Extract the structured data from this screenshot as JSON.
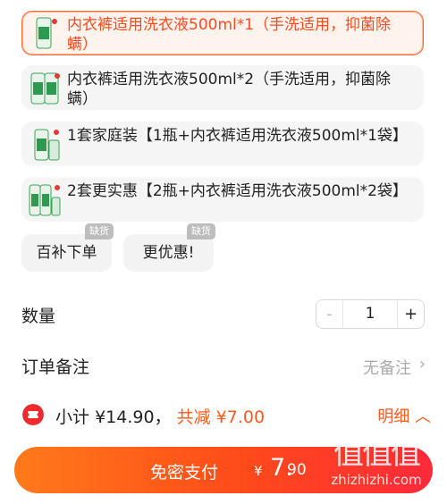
{
  "sku_options": [
    {
      "label": "内衣裤适用洗衣液500ml*1（手洗适用，抑菌除螨）",
      "selected": true
    },
    {
      "label": "内衣裤适用洗衣液500ml*2（手洗适用，抑菌除螨）",
      "selected": false
    },
    {
      "label": "1套家庭装【1瓶+内衣裤适用洗衣液500ml*1袋】",
      "selected": false
    },
    {
      "label": "2套更实惠【2瓶+内衣裤适用洗衣液500ml*2袋】",
      "selected": false
    }
  ],
  "sold_out_options": [
    {
      "label": "百补下单",
      "badge": "缺货"
    },
    {
      "label": "更优惠!",
      "badge": "缺货"
    }
  ],
  "quantity": {
    "label": "数量",
    "minus": "-",
    "value": "1",
    "plus": "+"
  },
  "remark": {
    "label": "订单备注",
    "value": "无备注",
    "arrow": "›"
  },
  "summary": {
    "subtotal_label": "小计",
    "subtotal": "¥14.90，",
    "discount_label": "共减",
    "discount": "¥7.00",
    "detail_label": "明细",
    "detail_arrow": "︿"
  },
  "pay_button": {
    "label": "免密支付",
    "currency": "¥",
    "amount_int": "7.",
    "amount_dec": "90"
  },
  "watermark": {
    "logo": "值值值",
    "url": "zhizhizhi.com"
  },
  "colors": {
    "accent": "#ff5a1f",
    "selected_border": "#ff6a33",
    "pay_start": "#ff7a1a",
    "pay_end": "#ff2a3a"
  }
}
